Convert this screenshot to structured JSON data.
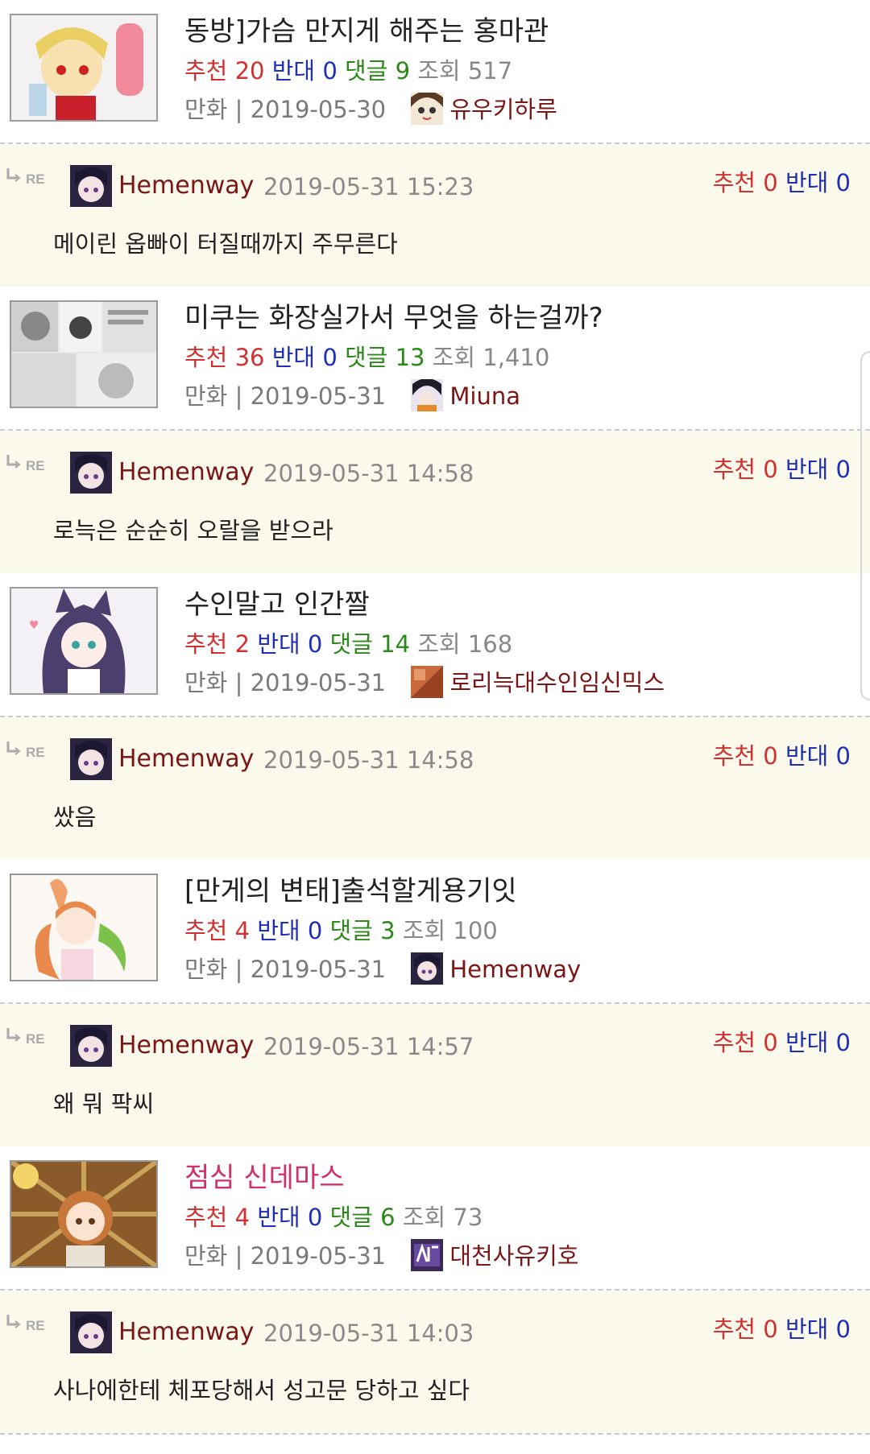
{
  "labels": {
    "recommend": "추천",
    "oppose": "반대",
    "comments": "댓글",
    "views": "조회",
    "category_sep": " | "
  },
  "posts": [
    {
      "title": "동방]가슴 만지게 해주는 홍마관",
      "recommend": "20",
      "oppose": "0",
      "comments": "9",
      "views": "517",
      "category": "만화",
      "date": "2019-05-30",
      "author": "유우키하루",
      "reply": {
        "author": "Hemenway",
        "date": "2019-05-31 15:23",
        "recommend": "0",
        "oppose": "0",
        "text": "메이린 옵빠이 터질때까지 주무른다"
      }
    },
    {
      "title": "미쿠는 화장실가서 무엇을 하는걸까?",
      "recommend": "36",
      "oppose": "0",
      "comments": "13",
      "views": "1,410",
      "category": "만화",
      "date": "2019-05-31",
      "author": "Miuna",
      "reply": {
        "author": "Hemenway",
        "date": "2019-05-31 14:58",
        "recommend": "0",
        "oppose": "0",
        "text": "로늑은 순순히 오랄을 받으라"
      }
    },
    {
      "title": "수인말고 인간짤",
      "recommend": "2",
      "oppose": "0",
      "comments": "14",
      "views": "168",
      "category": "만화",
      "date": "2019-05-31",
      "author": "로리늑대수인임신믹스",
      "reply": {
        "author": "Hemenway",
        "date": "2019-05-31 14:58",
        "recommend": "0",
        "oppose": "0",
        "text": "쌌음"
      }
    },
    {
      "title": "[만게의 변태]출석할게용기잇",
      "recommend": "4",
      "oppose": "0",
      "comments": "3",
      "views": "100",
      "category": "만화",
      "date": "2019-05-31",
      "author": "Hemenway",
      "reply": {
        "author": "Hemenway",
        "date": "2019-05-31 14:57",
        "recommend": "0",
        "oppose": "0",
        "text": "왜 뭐 팍씨"
      }
    },
    {
      "title": "점심 신데마스",
      "recommend": "4",
      "oppose": "0",
      "comments": "6",
      "views": "73",
      "category": "만화",
      "date": "2019-05-31",
      "author": "대천사유키호",
      "reply": {
        "author": "Hemenway",
        "date": "2019-05-31 14:03",
        "recommend": "0",
        "oppose": "0",
        "text": "사나에한테 체포당해서 성고문 당하고 싶다"
      }
    }
  ],
  "colors": {
    "recommend": "#d33030",
    "oppose": "#1f2fb8",
    "comments": "#2c8a1a",
    "nick": "#7a1616",
    "highlight_title": "#d0316a",
    "reply_bg": "#fbf8ec"
  }
}
